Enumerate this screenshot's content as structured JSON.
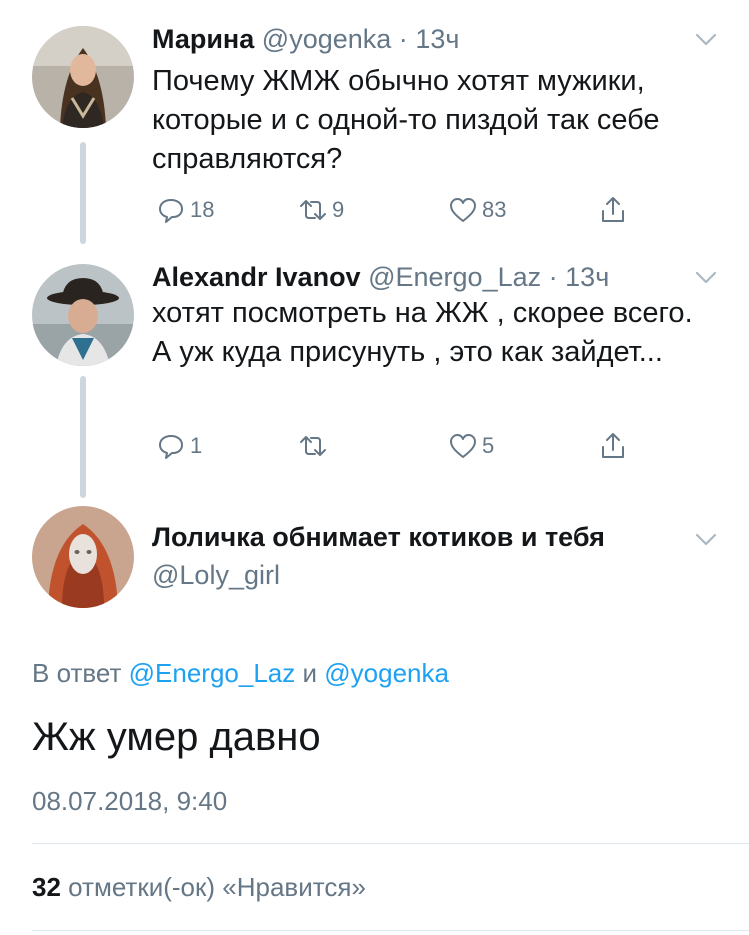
{
  "tweets": [
    {
      "name": "Марина",
      "handle": "@yogenka",
      "separator": "·",
      "time": "13ч",
      "text": "Почему ЖМЖ обычно хотят мужики, которые и с одной-то пиздой так себе справляются?",
      "replies": "18",
      "retweets": "9",
      "likes": "83"
    },
    {
      "name": "Alexandr Ivanov",
      "handle": "@Energo_Laz",
      "separator": "·",
      "time": "13ч",
      "text": "хотят посмотреть на ЖЖ , скорее всего.  А уж куда присунуть , это как зайдет...",
      "replies": "1",
      "retweets": "",
      "likes": "5"
    }
  ],
  "main_tweet": {
    "name": "Лоличка обнимает котиков и тебя",
    "handle": "@Loly_girl",
    "reply_prefix": "В ответ",
    "reply_mention_1": "@Energo_Laz",
    "reply_and": "и",
    "reply_mention_2": "@yogenka",
    "text": "Жж умер давно",
    "timestamp": "08.07.2018, 9:40",
    "like_count": "32",
    "like_label": "отметки(-ок) «Нравится»"
  },
  "colors": {
    "text": "#14171a",
    "secondary": "#657786",
    "accent": "#1da1f2",
    "thread_line": "#ccd6dd"
  },
  "icons": [
    "reply-icon",
    "retweet-icon",
    "like-icon",
    "share-icon",
    "chevron-down-icon"
  ]
}
